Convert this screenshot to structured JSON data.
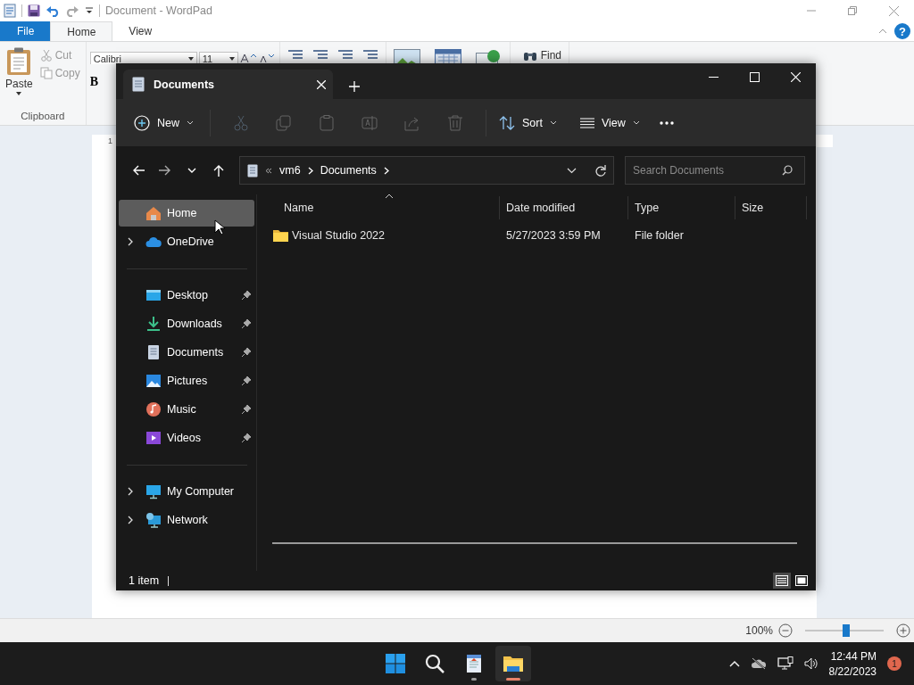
{
  "wordpad": {
    "title": "Document - WordPad",
    "tabs": [
      {
        "label": "File",
        "kind": "file",
        "selected": false
      },
      {
        "label": "Home",
        "kind": "tab",
        "selected": true
      },
      {
        "label": "View",
        "kind": "tab",
        "selected": false
      }
    ],
    "help": "?",
    "clipboard": {
      "paste": "Paste",
      "cut": "Cut",
      "copy": "Copy",
      "group": "Clipboard"
    },
    "font": {
      "family": "Calibri",
      "size": "11",
      "bold": "B"
    },
    "find": "Find",
    "ruler": {
      "mark": "1"
    },
    "zoom": {
      "reading": "100%",
      "level": 0.52
    }
  },
  "explorer": {
    "tab": "Documents",
    "new": "New",
    "actions": [
      {
        "kind": "cut",
        "disabled": true
      },
      {
        "kind": "copy",
        "disabled": true
      },
      {
        "kind": "paste",
        "disabled": true
      },
      {
        "kind": "rename",
        "disabled": true
      },
      {
        "kind": "share",
        "disabled": true
      },
      {
        "kind": "delete",
        "disabled": true
      }
    ],
    "sort": "Sort",
    "view": "View",
    "path": [
      "vm6",
      "Documents"
    ],
    "search": {
      "placeholder": "Search Documents"
    },
    "nav": [
      [
        {
          "label": "Home",
          "kind": "home",
          "selected": true,
          "expandable": false,
          "pinned": false
        },
        {
          "label": "OneDrive",
          "kind": "cloud",
          "selected": false,
          "expandable": true,
          "pinned": false
        }
      ],
      [
        {
          "label": "Desktop",
          "kind": "desktop",
          "selected": false,
          "expandable": false,
          "pinned": true
        },
        {
          "label": "Downloads",
          "kind": "downloads",
          "selected": false,
          "expandable": false,
          "pinned": true
        },
        {
          "label": "Documents",
          "kind": "documents",
          "selected": false,
          "expandable": false,
          "pinned": true
        },
        {
          "label": "Pictures",
          "kind": "pictures",
          "selected": false,
          "expandable": false,
          "pinned": true
        },
        {
          "label": "Music",
          "kind": "music",
          "selected": false,
          "expandable": false,
          "pinned": true
        },
        {
          "label": "Videos",
          "kind": "videos",
          "selected": false,
          "expandable": false,
          "pinned": true
        }
      ],
      [
        {
          "label": "My Computer",
          "kind": "computer",
          "selected": false,
          "expandable": true,
          "pinned": false
        },
        {
          "label": "Network",
          "kind": "network",
          "selected": false,
          "expandable": true,
          "pinned": false
        }
      ]
    ],
    "columns": [
      "Name",
      "Date modified",
      "Type",
      "Size"
    ],
    "rows": [
      {
        "name": "Visual Studio 2022",
        "date": "5/27/2023 3:59 PM",
        "type": "File folder"
      }
    ],
    "status": "1 item"
  },
  "taskbar": {
    "apps": [
      {
        "kind": "start",
        "selected": false,
        "running": false
      },
      {
        "kind": "search",
        "selected": false,
        "running": false
      },
      {
        "kind": "wordpad",
        "selected": false,
        "running": true
      },
      {
        "kind": "explorer",
        "selected": true,
        "running": true
      }
    ],
    "time": "12:44 PM",
    "date": "8/22/2023",
    "badge": "1"
  }
}
